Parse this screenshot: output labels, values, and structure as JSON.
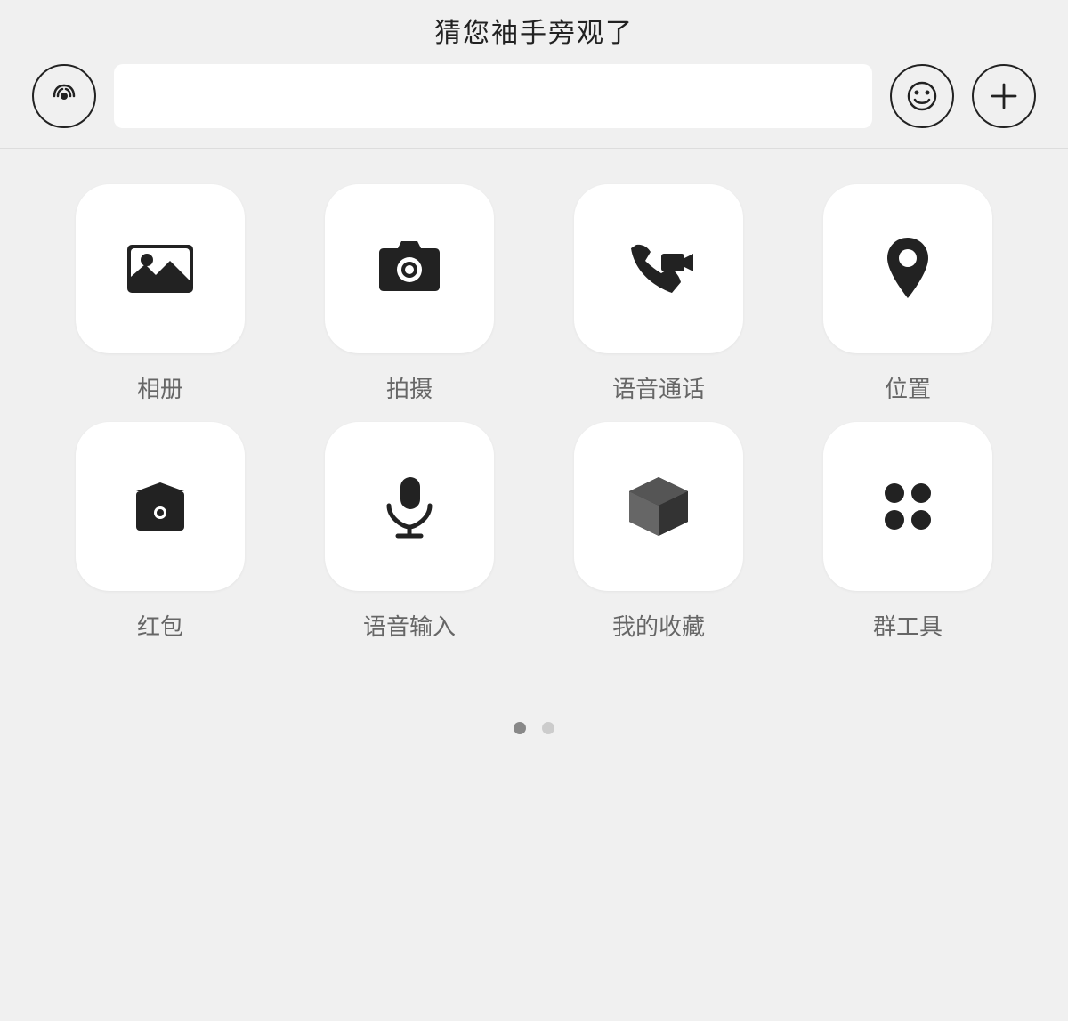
{
  "topbar": {
    "title": "猜您袖手旁观了"
  },
  "inputbar": {
    "voice_icon": "voice-icon",
    "emoji_icon": "emoji-icon",
    "add_icon": "add-icon",
    "input_placeholder": ""
  },
  "grid_row1": [
    {
      "id": "album",
      "label": "相册",
      "icon": "album-icon"
    },
    {
      "id": "camera",
      "label": "拍摄",
      "icon": "camera-icon"
    },
    {
      "id": "voicecall",
      "label": "语音通话",
      "icon": "voicecall-icon"
    },
    {
      "id": "location",
      "label": "位置",
      "icon": "location-icon"
    }
  ],
  "grid_row2": [
    {
      "id": "redpacket",
      "label": "红包",
      "icon": "redpacket-icon"
    },
    {
      "id": "voiceinput",
      "label": "语音输入",
      "icon": "voiceinput-icon"
    },
    {
      "id": "favorites",
      "label": "我的收藏",
      "icon": "favorites-icon"
    },
    {
      "id": "grouptools",
      "label": "群工具",
      "icon": "grouptools-icon"
    }
  ],
  "pagination": {
    "active_dot": 0,
    "total_dots": 2
  }
}
